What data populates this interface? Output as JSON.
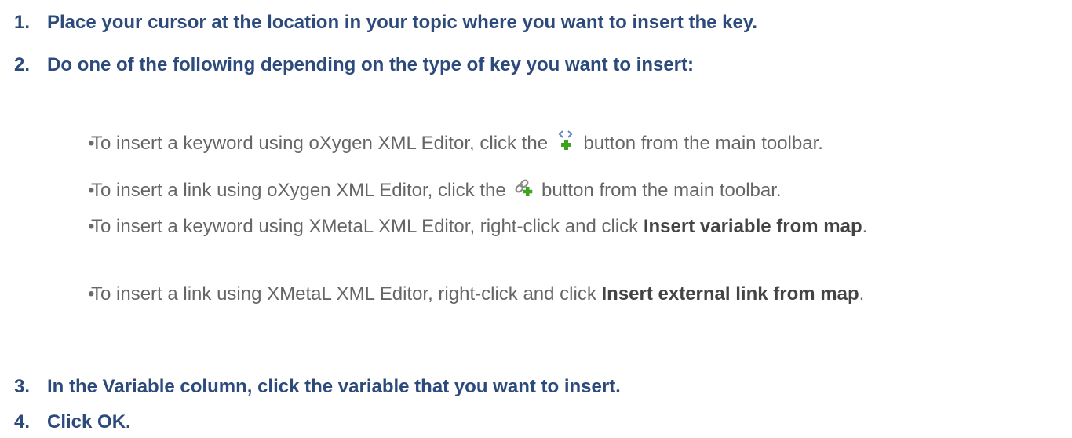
{
  "steps": [
    {
      "num": "1.",
      "text": "Place your cursor at the location in your topic where you want to insert the key."
    },
    {
      "num": "2.",
      "text": "Do one of the following depending on the type of key you want to insert:"
    },
    {
      "num": "3.",
      "text": "In the Variable column, click the variable that you want to insert."
    },
    {
      "num": "4.",
      "text": "Click OK."
    }
  ],
  "bullets": [
    {
      "pre": "To insert a keyword using oXygen XML Editor, click the",
      "icon": "insert-keyword-icon",
      "post": "button from the main toolbar."
    },
    {
      "pre": "To insert a link using oXygen XML Editor, click the",
      "icon": "insert-link-icon",
      "post": "button from the main toolbar."
    },
    {
      "pre": "To insert a keyword using XMetaL XML Editor, right-click and click",
      "bold": "Insert variable from map",
      "post": "."
    },
    {
      "pre": "To insert a link using XMetaL XML Editor, right-click and click",
      "bold": "Insert external link from map",
      "post": "."
    }
  ],
  "bullet_symbol": "•",
  "colors": {
    "heading": "#2c4a7c",
    "body": "#666666"
  }
}
